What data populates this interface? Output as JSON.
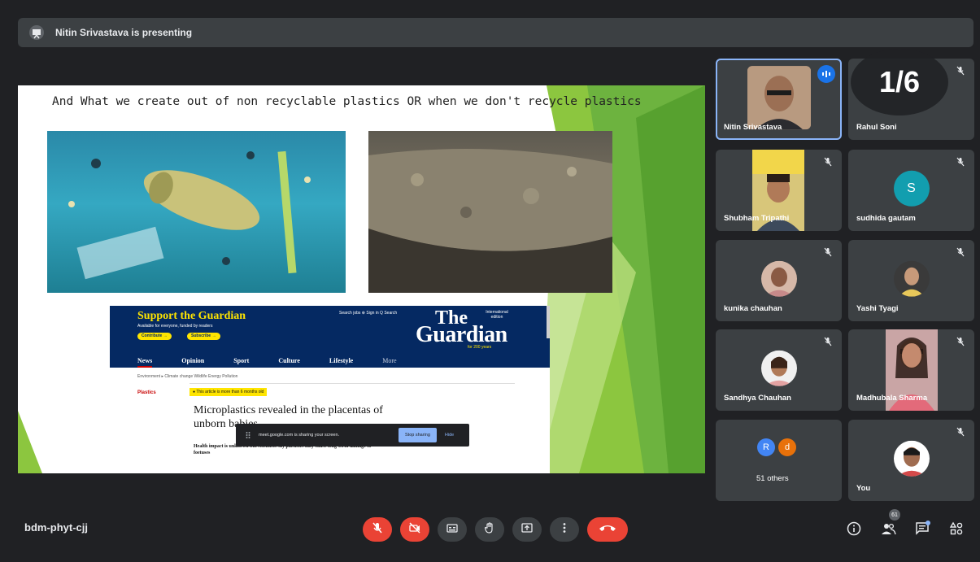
{
  "presenter_banner": {
    "text": "Nitin Srivastava is presenting"
  },
  "slide": {
    "title": "And What we create out of non recyclable plastics OR when we don't recycle plastics",
    "guardian": {
      "support": "Support the Guardian",
      "support_sub": "Available for everyone, funded by readers",
      "contribute": "Contribute →",
      "subscribe": "Subscribe →",
      "top_links": "Search jobs   ⊕ Sign in   Q Search",
      "edition": "International edition",
      "logo_the": "The",
      "logo_guardian": "Guardian",
      "years": "for 200 years",
      "nav": [
        "News",
        "Opinion",
        "Sport",
        "Culture",
        "Lifestyle",
        "More"
      ],
      "sections": "Environment ▸ Climate change  Wildlife  Energy  Pollution",
      "tag": "Plastics",
      "age_badge": "● This article is more than 6 months old",
      "headline": "Microplastics revealed in the placentas of unborn babies",
      "standfirst": "Health impact is unknown but scientists say particles may cause long-term damage to foetuses"
    }
  },
  "share_bar": {
    "text": "meet.google.com is sharing your screen.",
    "stop_label": "Stop sharing",
    "hide_label": "Hide"
  },
  "page_indicator": "1/6",
  "participants": [
    {
      "name": "Nitin Srivastava",
      "avatar": "photo",
      "muted": false,
      "speaking": true
    },
    {
      "name": "Rahul Soni",
      "avatar": "none",
      "muted": true
    },
    {
      "name": "Shubham Tripathi",
      "avatar": "photo",
      "muted": true
    },
    {
      "name": "sudhida gautam",
      "avatar": "S",
      "avatar_color": "#129eaf",
      "muted": true
    },
    {
      "name": "kunika chauhan",
      "avatar": "photo",
      "muted": true
    },
    {
      "name": "Yashi Tyagi",
      "avatar": "photo",
      "muted": true
    },
    {
      "name": "Sandhya Chauhan",
      "avatar": "photo",
      "muted": true
    },
    {
      "name": "Madhubala Sharma",
      "avatar": "photo",
      "muted": true
    },
    {
      "name": "51 others",
      "avatar": "R d",
      "muted": false
    },
    {
      "name": "You",
      "avatar": "photo",
      "muted": true
    }
  ],
  "others_initials": [
    "R",
    "d"
  ],
  "meeting_code": "bdm-phyt-cjj",
  "participant_count": "61",
  "colors": {
    "end_call": "#ea4335",
    "background": "#202124",
    "tile": "#3c4043",
    "accent": "#8ab4f8"
  }
}
